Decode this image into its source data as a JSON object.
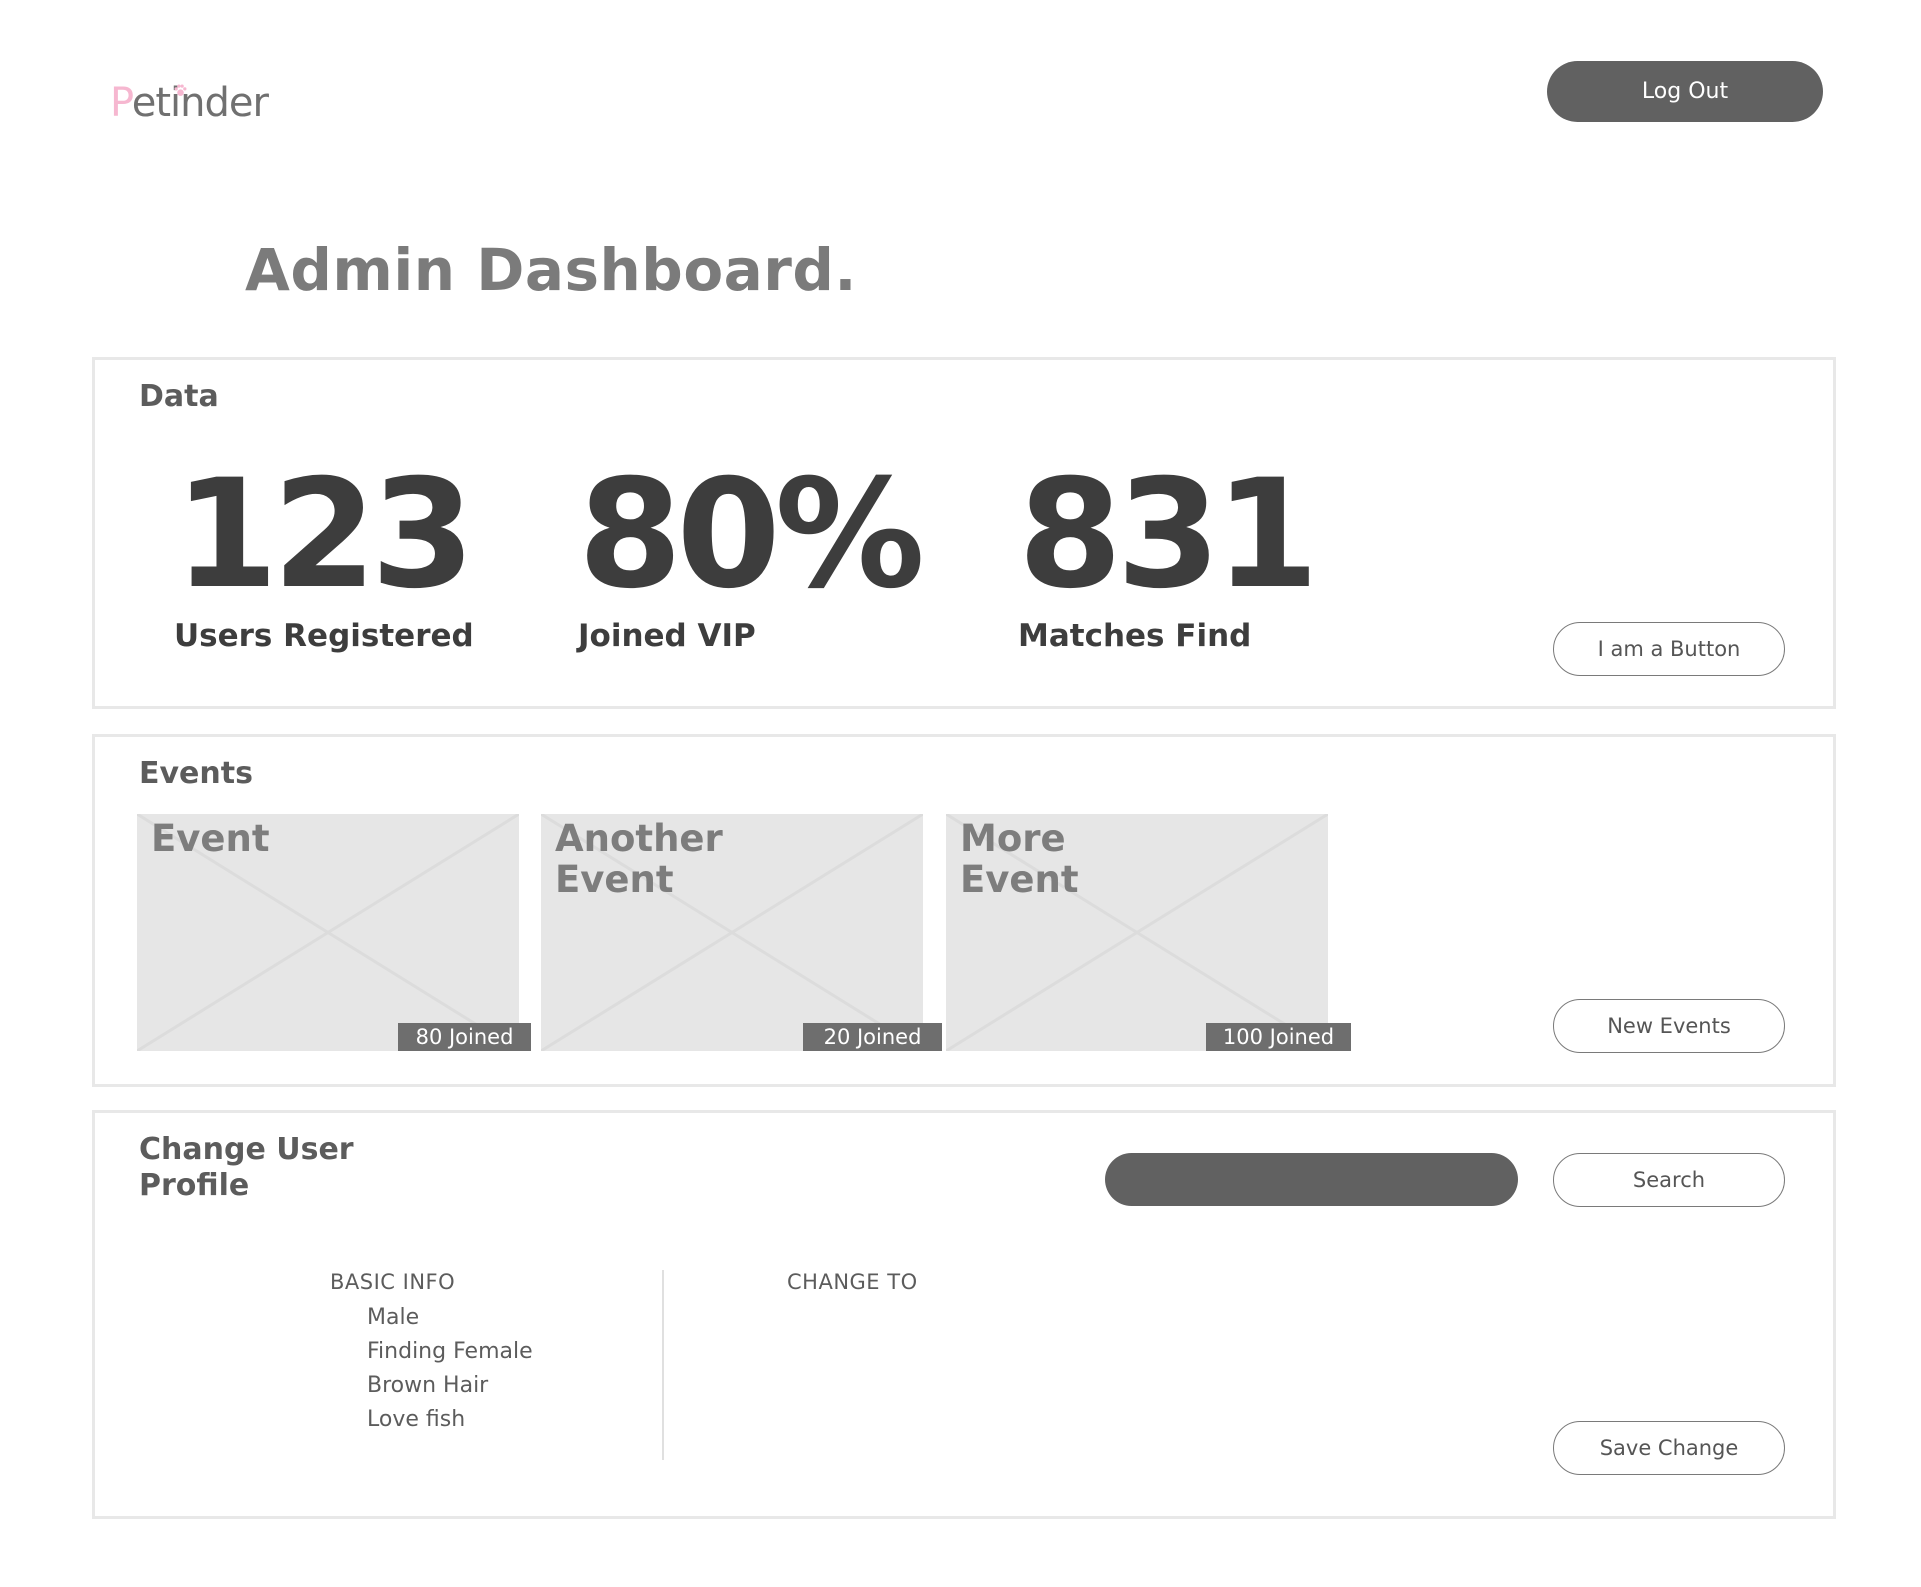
{
  "header": {
    "logo_first_letter": "P",
    "logo_rest": "etinder",
    "logout_label": "Log Out"
  },
  "page_title": "Admin Dashboard.",
  "data_panel": {
    "title": "Data",
    "stats": [
      {
        "value": "123",
        "label": "Users Registered"
      },
      {
        "value": "80%",
        "label": "Joined VIP"
      },
      {
        "value": "831",
        "label": "Matches Find"
      }
    ],
    "button_label": "I am a Button"
  },
  "events_panel": {
    "title": "Events",
    "events": [
      {
        "title": "Event",
        "joined": "80 Joined"
      },
      {
        "title": "Another\nEvent",
        "joined": "20 Joined"
      },
      {
        "title": "More\nEvent",
        "joined": "100 Joined"
      }
    ],
    "new_events_label": "New Events"
  },
  "profile_panel": {
    "title_line1": "Change User",
    "title_line2": "Profile",
    "search_value": "",
    "search_label": "Search",
    "basic_info_heading": "BASIC INFO",
    "basic_info_items": [
      "Male",
      "Finding Female",
      "Brown Hair",
      "Love fish"
    ],
    "change_to_heading": "CHANGE TO",
    "save_label": "Save Change"
  },
  "colors": {
    "accent_pink": "#f6b7d0",
    "dark_button": "#616161",
    "text_dark": "#3d3d3d",
    "placeholder_gray": "#e6e6e6"
  },
  "icons": {
    "logo_paw": "paw-icon",
    "event_placeholder": "image-placeholder-icon"
  }
}
